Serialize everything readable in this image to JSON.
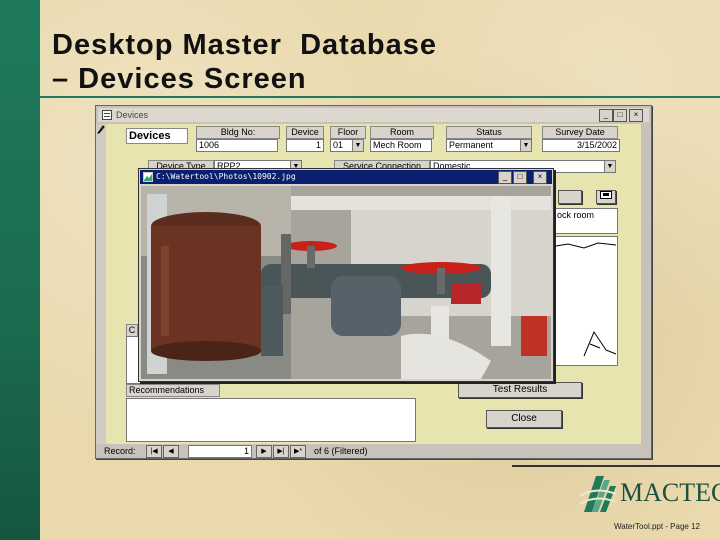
{
  "slide": {
    "title_line1": "Desktop Master  Database",
    "title_line2": "– Devices Screen",
    "footer": "WaterTool.ppt - Page 12",
    "brand": "MACTEC"
  },
  "devices_window": {
    "title": "Devices",
    "form_heading": "Devices",
    "labels": {
      "bldg_no": "Bldg No:",
      "device": "Device",
      "floor": "Floor",
      "room": "Room",
      "status": "Status",
      "survey_date": "Survey Date",
      "device_type": "Device Type",
      "service_connection": "Service Connection",
      "recommendations": "Recommendations",
      "c": "C"
    },
    "values": {
      "bldg_no": "1006",
      "device": "1",
      "floor": "01",
      "room": "Mech Room",
      "status": "Permanent",
      "survey_date": "3/15/2002",
      "device_type": "RPP2",
      "service_connection": "Domestic",
      "side_text": "ock room"
    },
    "buttons": {
      "test_results": "Test Results",
      "close": "Close"
    },
    "record_nav": {
      "label": "Record:",
      "current": "1",
      "of_text": "of  6 (Filtered)"
    }
  },
  "photo_window": {
    "title": "C:\\Watertool\\Photos\\10902.jpg"
  },
  "colors": {
    "accent_green": "#1f7a5c",
    "background_parchment": "#e9d9ad",
    "photo_titlebar": "#0a1f6e"
  }
}
